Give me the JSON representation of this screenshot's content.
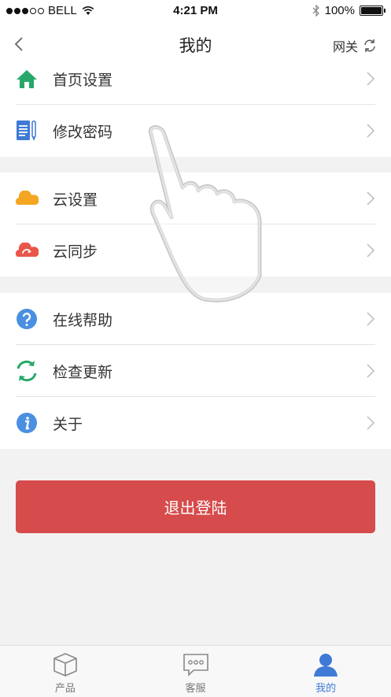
{
  "status_bar": {
    "carrier": "BELL",
    "time": "4:21 PM",
    "battery": "100%"
  },
  "nav": {
    "title": "我的",
    "gateway_label": "网关"
  },
  "section1": [
    {
      "label": "首页设置",
      "icon": "home-icon"
    },
    {
      "label": "修改密码",
      "icon": "document-pen-icon"
    }
  ],
  "section2": [
    {
      "label": "云设置",
      "icon": "cloud-icon"
    },
    {
      "label": "云同步",
      "icon": "cloud-sync-icon"
    }
  ],
  "section3": [
    {
      "label": "在线帮助",
      "icon": "help-icon"
    },
    {
      "label": "检查更新",
      "icon": "refresh-icon"
    },
    {
      "label": "关于",
      "icon": "info-icon"
    }
  ],
  "logout_label": "退出登陆",
  "tabs": [
    {
      "label": "产品",
      "icon": "cube-icon"
    },
    {
      "label": "客服",
      "icon": "chat-icon"
    },
    {
      "label": "我的",
      "icon": "user-icon"
    }
  ],
  "colors": {
    "accent": "#3f7ad6",
    "logout": "#d64b4b",
    "home": "#27a86a",
    "cloud": "#f4a623",
    "cloud_sync": "#e8574a",
    "help": "#4a90e2",
    "refresh": "#27a86a"
  }
}
